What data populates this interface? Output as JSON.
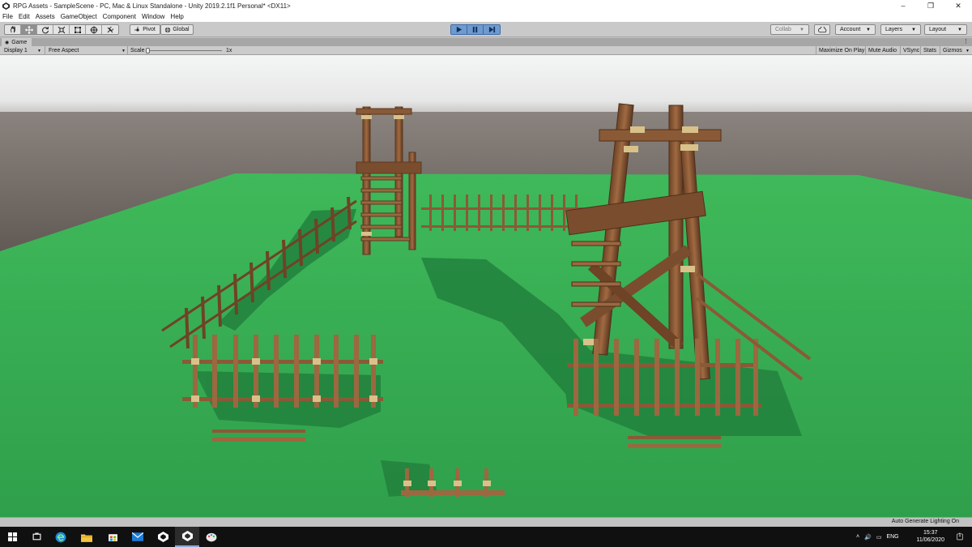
{
  "window": {
    "title": "RPG Assets - SampleScene - PC, Mac & Linux Standalone - Unity 2019.2.1f1 Personal* <DX11>",
    "controls": {
      "minimize": "–",
      "maximize": "❐",
      "close": "✕"
    }
  },
  "menu": [
    "File",
    "Edit",
    "Assets",
    "GameObject",
    "Component",
    "Window",
    "Help"
  ],
  "toolbar": {
    "tools": [
      "hand-tool",
      "move-tool",
      "rotate-tool",
      "scale-tool",
      "rect-tool",
      "transform-tool",
      "custom-tool"
    ],
    "active_tool": "move-tool",
    "pivot_label": "Pivot",
    "global_label": "Global",
    "collab_label": "Collab",
    "account_label": "Account",
    "layers_label": "Layers",
    "layout_label": "Layout",
    "play_state": "playing",
    "accent_color": "#6f9ad0"
  },
  "game_view": {
    "tab_label": "Game",
    "display_label": "Display 1",
    "aspect_label": "Free Aspect",
    "scale_label": "Scale",
    "scale_value": "1x",
    "toggles": [
      "Maximize On Play",
      "Mute Audio",
      "VSync",
      "Stats",
      "Gizmos"
    ]
  },
  "status": {
    "message": "Auto Generate Lighting On"
  },
  "scene": {
    "sky_color": "#f2f4f4",
    "horizon_color": "#6e6660",
    "ground_color": "#34a852",
    "wood_color": "#8a5a36",
    "rope_color": "#d8c28a"
  },
  "taskbar": {
    "items": [
      "start-icon",
      "task-view-icon",
      "edge-icon",
      "file-explorer-icon",
      "store-icon",
      "mail-icon",
      "unity-hub-icon",
      "unity-icon",
      "paint-icon"
    ],
    "active_item": "unity-icon",
    "tray": {
      "language": "ENG",
      "time": "15:37",
      "date": "11/06/2020",
      "notification_count": "1"
    }
  }
}
